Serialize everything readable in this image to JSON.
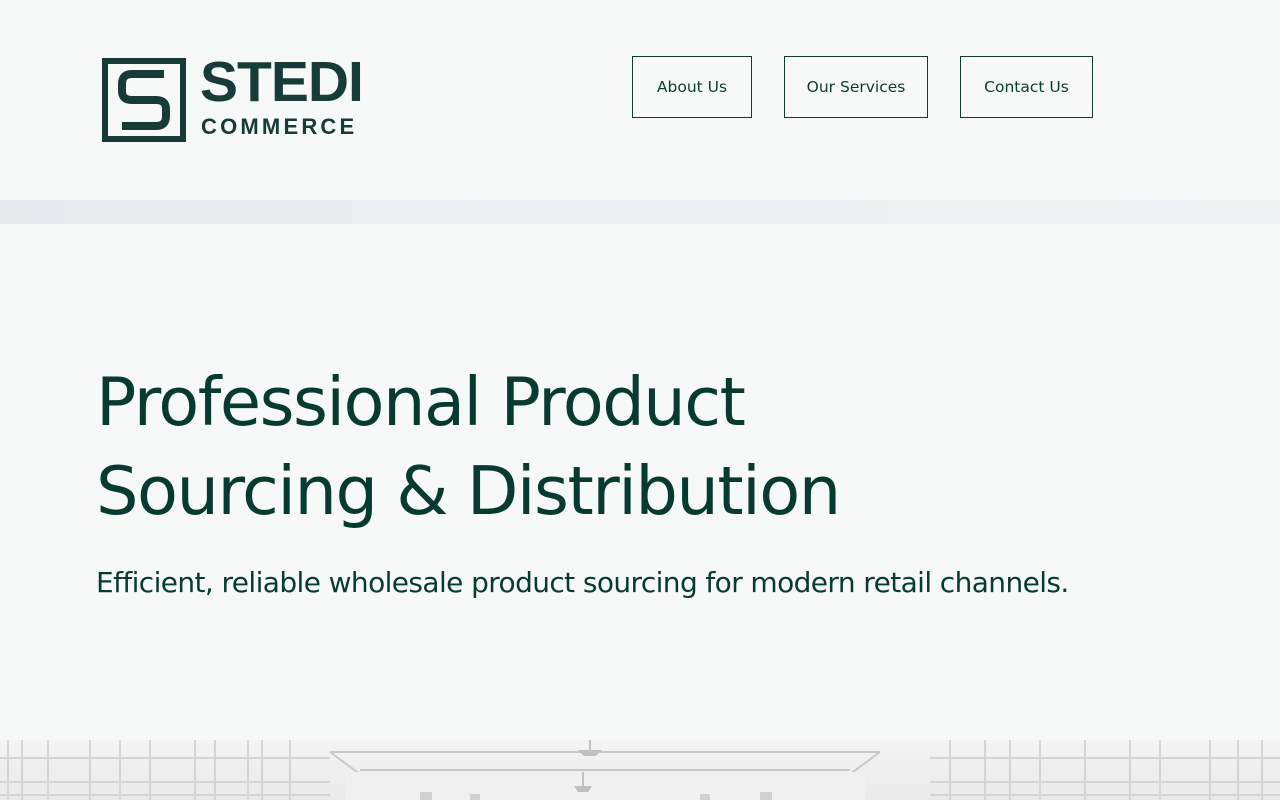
{
  "brand": {
    "name": "STEDI",
    "subname": "COMMERCE",
    "mark_letter": "S",
    "color": "#173c37"
  },
  "nav": {
    "items": [
      {
        "label": "About Us"
      },
      {
        "label": "Our Services"
      },
      {
        "label": "Contact Us"
      }
    ]
  },
  "hero": {
    "title_line1": "Professional Product",
    "title_line2": "Sourcing & Distribution",
    "subtitle": "Efficient, reliable wholesale product sourcing for modern retail channels."
  },
  "colors": {
    "primary": "#073b30",
    "background": "#f7f8f8",
    "band": "#eceff1"
  }
}
